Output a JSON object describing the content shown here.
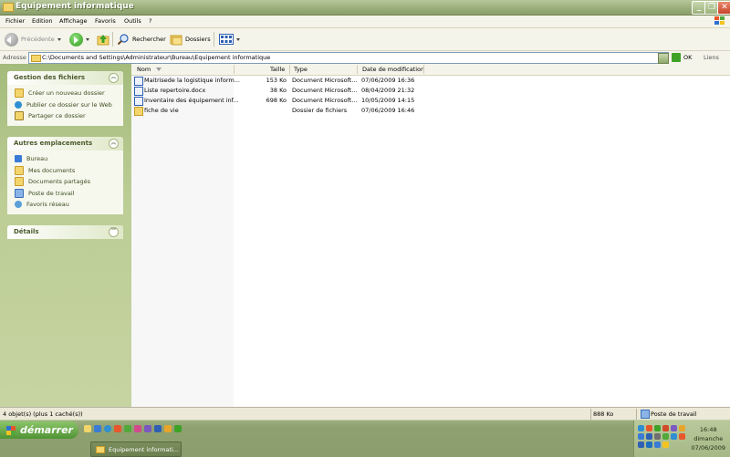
{
  "window": {
    "title": "Equipement informatique"
  },
  "menu": {
    "items": [
      "Fichier",
      "Edition",
      "Affichage",
      "Favoris",
      "Outils",
      "?"
    ]
  },
  "toolbar": {
    "back": "Précédente",
    "search": "Rechercher",
    "folders": "Dossiers"
  },
  "address": {
    "label": "Adresse",
    "path": "C:\\Documents and Settings\\Administrateur\\Bureau\\Equipement informatique",
    "go": "OK",
    "links": "Liens"
  },
  "tasks_panel": {
    "title": "Gestion des fichiers",
    "items": [
      {
        "label": "Créer un nouveau dossier",
        "icon": "new-folder-icon"
      },
      {
        "label": "Publier ce dossier sur le Web",
        "icon": "web-publish-icon"
      },
      {
        "label": "Partager ce dossier",
        "icon": "share-icon"
      }
    ]
  },
  "places_panel": {
    "title": "Autres emplacements",
    "items": [
      {
        "label": "Bureau",
        "icon": "desktop-icon"
      },
      {
        "label": "Mes documents",
        "icon": "my-documents-icon"
      },
      {
        "label": "Documents partagés",
        "icon": "shared-documents-icon"
      },
      {
        "label": "Poste de travail",
        "icon": "my-computer-icon"
      },
      {
        "label": "Favoris réseau",
        "icon": "network-icon"
      }
    ]
  },
  "details_panel": {
    "title": "Détails"
  },
  "columns": {
    "name": "Nom",
    "size": "Taille",
    "type": "Type",
    "modified": "Date de modification"
  },
  "files": [
    {
      "name": "Maitrisede la logistique inform...",
      "size": "153 Ko",
      "type": "Document Microsoft...",
      "modified": "07/06/2009 16:36",
      "kind": "doc"
    },
    {
      "name": "Liste  repertoire.docx",
      "size": "38 Ko",
      "type": "Document Microsoft...",
      "modified": "08/04/2009 21:32",
      "kind": "doc"
    },
    {
      "name": "Inventaire des équipement inf...",
      "size": "698 Ko",
      "type": "Document Microsoft...",
      "modified": "10/05/2009 14:15",
      "kind": "doc"
    },
    {
      "name": "fiche de vie",
      "size": "",
      "type": "Dossier de fichiers",
      "modified": "07/06/2009 16:46",
      "kind": "folder"
    }
  ],
  "status": {
    "objects": "4 objet(s) (plus 1 caché(s))",
    "size": "888 Ko",
    "location": "Poste de travail"
  },
  "taskbar": {
    "start": "démarrer",
    "window_button": "Equipement informati...",
    "time": "16:48",
    "day": "dimanche",
    "date": "07/06/2009"
  }
}
